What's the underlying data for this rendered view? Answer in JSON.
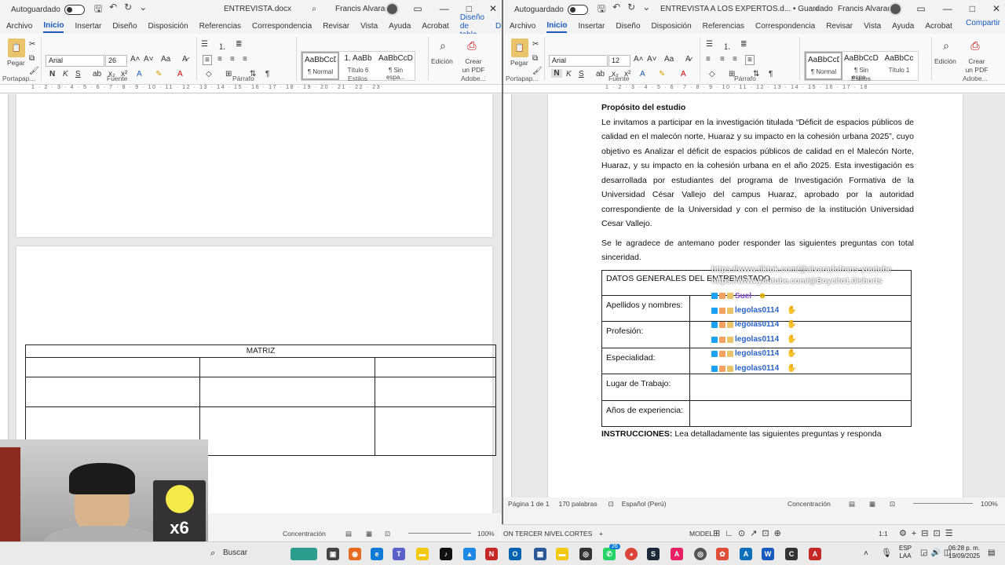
{
  "left_window": {
    "autosave_label": "Autoguardado",
    "doc_title": "ENTREVISTA.docx",
    "user": "Francis Alvarado",
    "menu": [
      "Archivo",
      "Inicio",
      "Insertar",
      "Diseño",
      "Disposición",
      "Referencias",
      "Correspondencia",
      "Revisar",
      "Vista",
      "Ayuda",
      "Acrobat"
    ],
    "menu_active": "Inicio",
    "context_tabs": [
      "Diseño de tabla",
      "Disposición"
    ],
    "font_name": "Arial",
    "font_size": "26",
    "styles": [
      {
        "preview": "AaBbCcDc",
        "name": "¶ Normal"
      },
      {
        "preview": "1. AaBb",
        "name": "Título 6"
      },
      {
        "preview": "AaBbCcDc",
        "name": "¶ Sin espa..."
      }
    ],
    "groups": {
      "clipboard": "Portapap...",
      "font": "Fuente",
      "paragraph": "Párrafo",
      "styles": "Estilos",
      "adobe": "Adobe..."
    },
    "paste_label": "Pegar",
    "edit_label": "Edición",
    "pdf_label": "Crear un PDF",
    "ruler_numbers": "1 · 2 · 3 · 4 · 5 · 6 · 7 · 8 · 9 · 10 · 11 · 12 · 13 · 14 · 15 · 16 · 17 · 18 · 19 · 20 · 21 · 22 · 23",
    "table_title": "MATRIZ",
    "status_focus": "Concentración",
    "zoom": "100%"
  },
  "right_window": {
    "autosave_label": "Autoguardado",
    "doc_title": "ENTREVISTA A LOS EXPERTOS.d...",
    "save_state": "Guardado",
    "user": "Francis Alvarado",
    "menu": [
      "Archivo",
      "Inicio",
      "Insertar",
      "Diseño",
      "Disposición",
      "Referencias",
      "Correspondencia",
      "Revisar",
      "Vista",
      "Ayuda",
      "Acrobat"
    ],
    "menu_active": "Inicio",
    "share_label": "Compartir",
    "font_name": "Arial",
    "font_size": "12",
    "styles": [
      {
        "preview": "AaBbCcDc",
        "name": "¶ Normal"
      },
      {
        "preview": "AaBbCcDc",
        "name": "¶ Sin espa..."
      },
      {
        "preview": "AaBbCc",
        "name": "Título 1"
      }
    ],
    "groups": {
      "clipboard": "Portapap...",
      "font": "Fuente",
      "paragraph": "Párrafo",
      "styles": "Estilos",
      "adobe": "Adobe..."
    },
    "paste_label": "Pegar",
    "edit_label": "Edición",
    "pdf_label": "Crear un PDF",
    "ruler_numbers": "1 · 2 · 3 · 4 · 5 · 6 · 7 · 8 · 9 · 10 · 11 · 12 · 13 · 14 · 15 · 16 · 17 · 18",
    "heading": "Propósito del estudio",
    "paragraph1": "Le invitamos a participar en la investigación titulada “Déficit de espacios públicos de calidad en el malecón norte, Huaraz y su impacto en la cohesión urbana 2025”, cuyo objetivo es Analizar el déficit de espacios públicos de calidad en el Malecón Norte, Huaraz, y su impacto en la cohesión urbana en el año 2025. Esta investigación es desarrollada por estudiantes del programa de Investigación Formativa de la Universidad César Vallejo del campus Huaraz, aprobado por la autoridad correspondiente de la Universidad y con el permiso de la institución Universidad Cesar Vallejo.",
    "paragraph2": "Se le agradece de antemano poder responder las siguientes preguntas con total sinceridad.",
    "table_header": "DATOS GENERALES DEL ENTREVISTADO",
    "table_rows": [
      "Apellidos y nombres:",
      "Profesión:",
      "Especialidad:",
      "Lugar de Trabajo:",
      "Años de experiencia:"
    ],
    "instructions_bold": "INSTRUCCIONES:",
    "instructions_text": " Lea detalladamente las siguientes preguntas y responda",
    "status_page": "Página 1 de 1",
    "status_words": "170 palabras",
    "status_lang": "Español (Perú)",
    "status_focus": "Concentración",
    "zoom": "100%"
  },
  "overlay": {
    "link1": "https://www.tiktok.com/@alvaradofrans-youtube",
    "link2": "https://www.youtube.com/@Boycito1.0/shorts",
    "chat_user1": "Suel ·",
    "chat_user2": "legolas0114"
  },
  "badge": "x6",
  "bottom_strip": {
    "left_label": "ON TERCER NIVEL",
    "tab": "CORTES",
    "model_label": "MODEL",
    "scale": "1:1"
  },
  "taskbar": {
    "search_placeholder": "Buscar",
    "lang_top": "ESP",
    "lang_bottom": "LAA",
    "time": "06:28 p. m.",
    "date": "19/09/2025",
    "notification_count": "26"
  }
}
